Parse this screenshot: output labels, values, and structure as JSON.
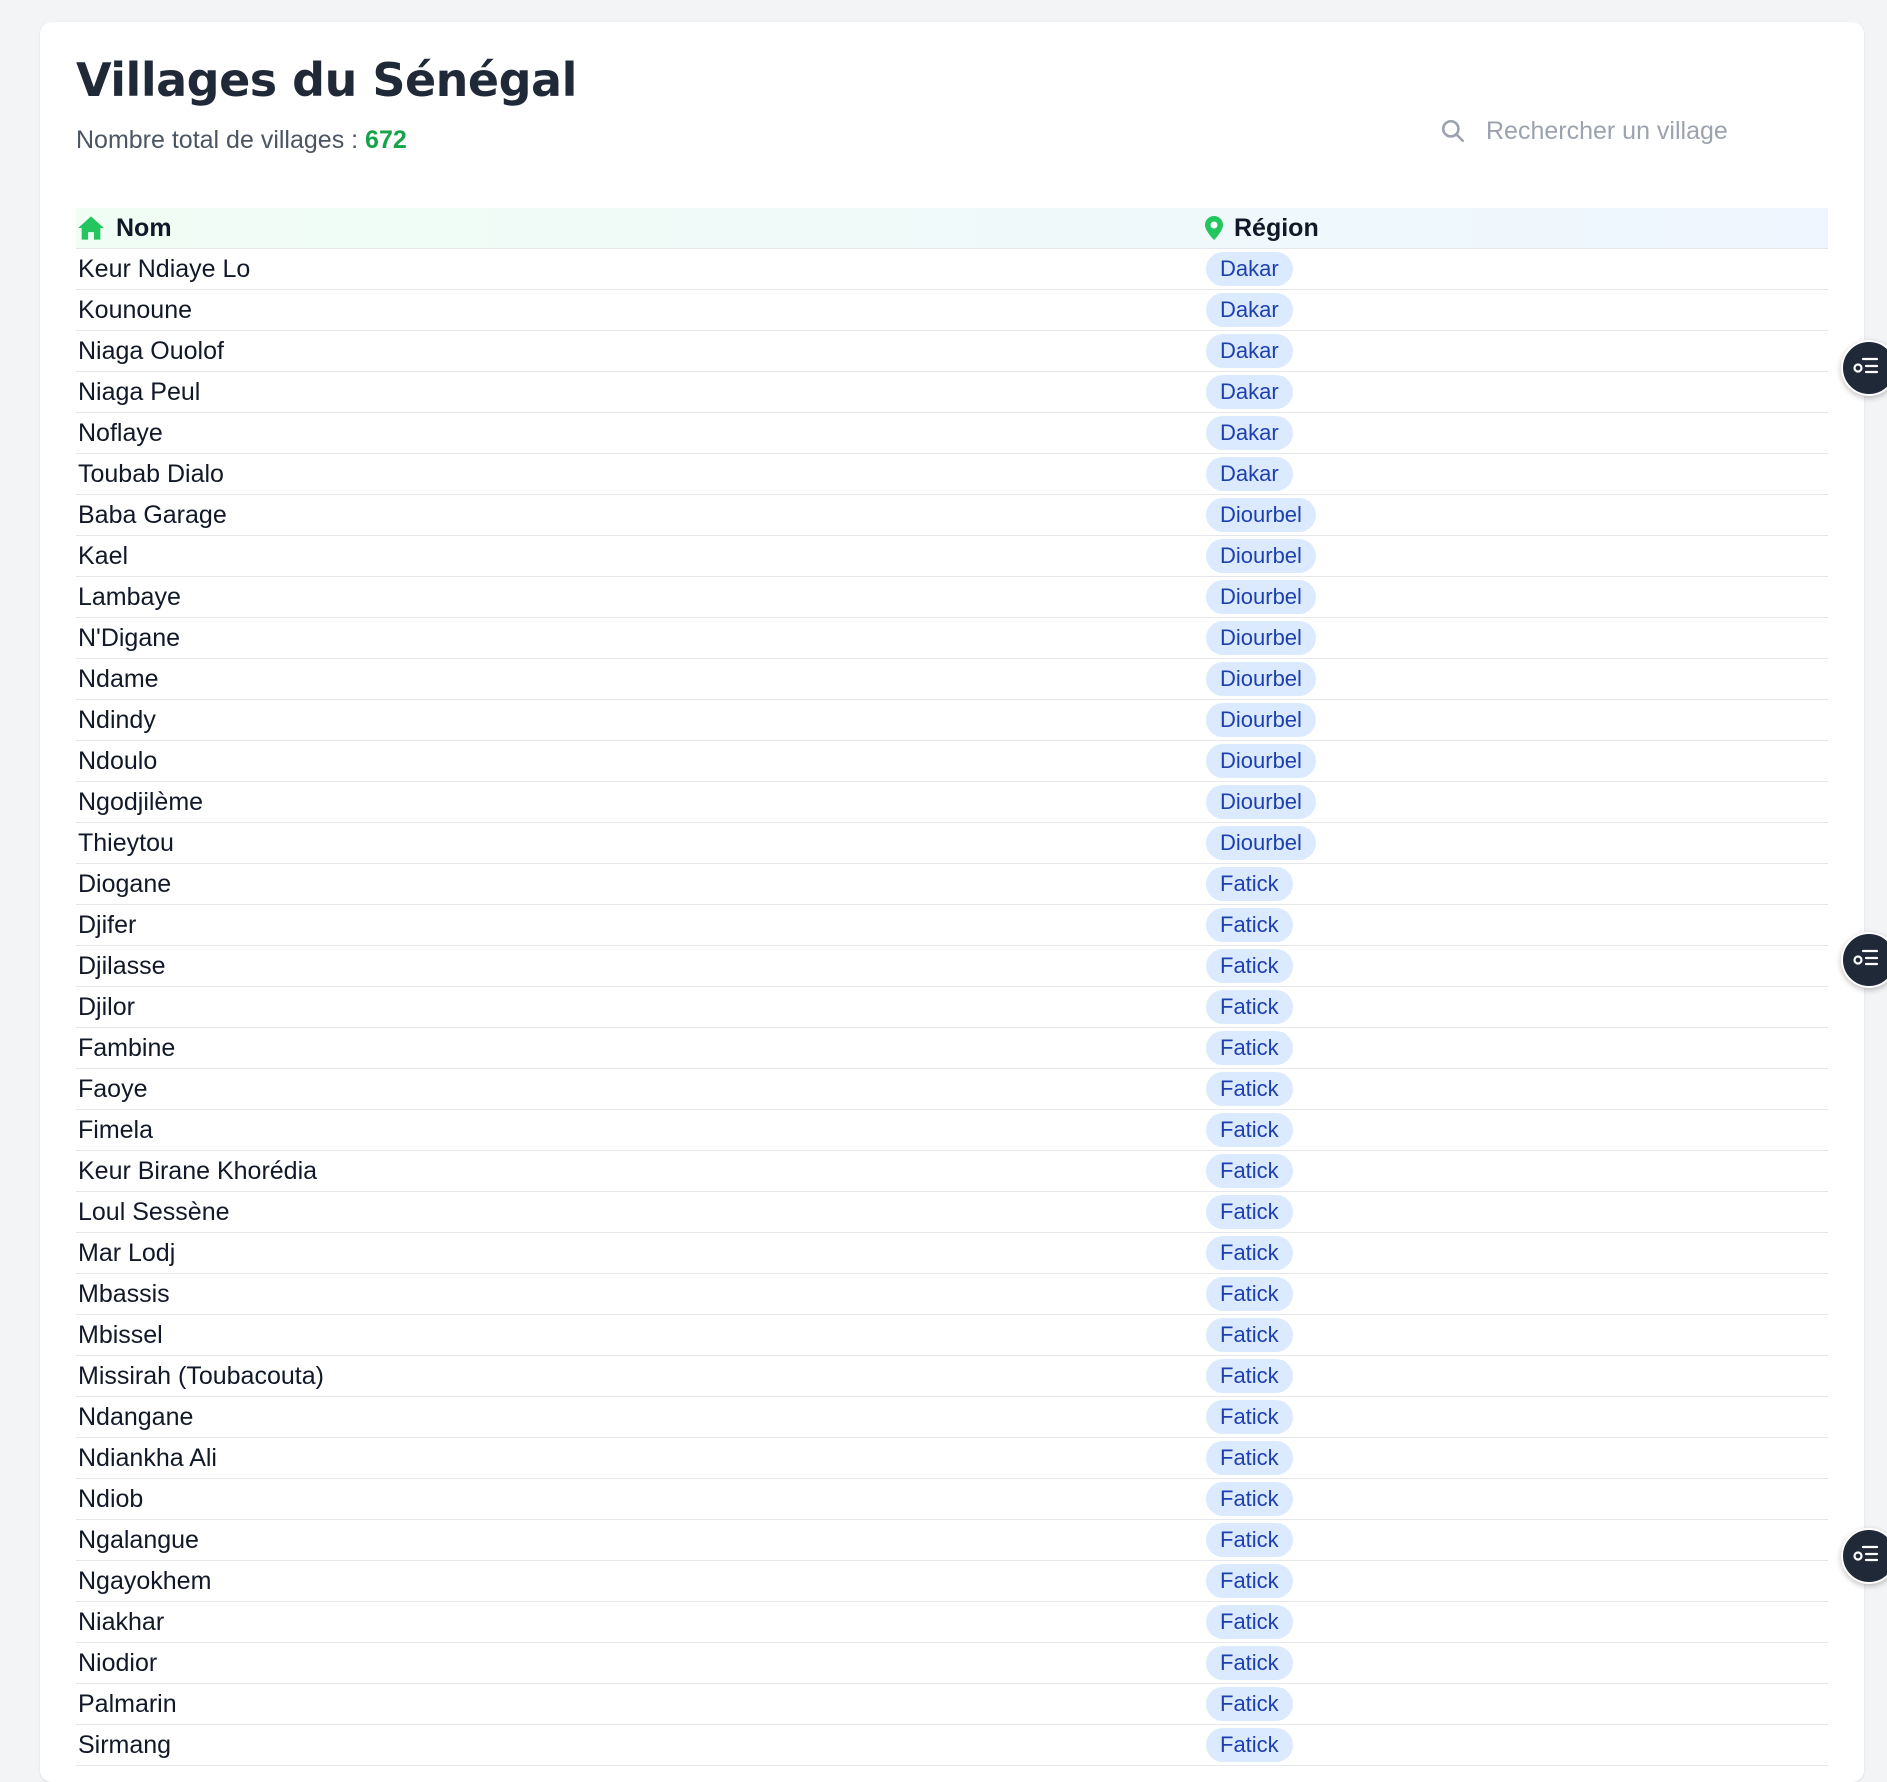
{
  "header": {
    "title": "Villages du Sénégal",
    "subtitle_label": "Nombre total de villages :",
    "total_count": "672"
  },
  "search": {
    "placeholder": "Rechercher un village",
    "icon": "search-icon"
  },
  "table": {
    "columns": [
      {
        "label": "Nom",
        "icon": "home-icon"
      },
      {
        "label": "Région",
        "icon": "map-pin-icon"
      }
    ],
    "rows": [
      {
        "name": "Keur Ndiaye Lo",
        "region": "Dakar"
      },
      {
        "name": "Kounoune",
        "region": "Dakar"
      },
      {
        "name": "Niaga Ouolof",
        "region": "Dakar"
      },
      {
        "name": "Niaga Peul",
        "region": "Dakar"
      },
      {
        "name": "Noflaye",
        "region": "Dakar"
      },
      {
        "name": "Toubab Dialo",
        "region": "Dakar"
      },
      {
        "name": "Baba Garage",
        "region": "Diourbel"
      },
      {
        "name": "Kael",
        "region": "Diourbel"
      },
      {
        "name": "Lambaye",
        "region": "Diourbel"
      },
      {
        "name": "N'Digane",
        "region": "Diourbel"
      },
      {
        "name": "Ndame",
        "region": "Diourbel"
      },
      {
        "name": "Ndindy",
        "region": "Diourbel"
      },
      {
        "name": "Ndoulo",
        "region": "Diourbel"
      },
      {
        "name": "Ngodjilème",
        "region": "Diourbel"
      },
      {
        "name": "Thieytou",
        "region": "Diourbel"
      },
      {
        "name": "Diogane",
        "region": "Fatick"
      },
      {
        "name": "Djifer",
        "region": "Fatick"
      },
      {
        "name": "Djilasse",
        "region": "Fatick"
      },
      {
        "name": "Djilor",
        "region": "Fatick"
      },
      {
        "name": "Fambine",
        "region": "Fatick"
      },
      {
        "name": "Faoye",
        "region": "Fatick"
      },
      {
        "name": "Fimela",
        "region": "Fatick"
      },
      {
        "name": "Keur Birane Khorédia",
        "region": "Fatick"
      },
      {
        "name": "Loul Sessène",
        "region": "Fatick"
      },
      {
        "name": "Mar Lodj",
        "region": "Fatick"
      },
      {
        "name": "Mbassis",
        "region": "Fatick"
      },
      {
        "name": "Mbissel",
        "region": "Fatick"
      },
      {
        "name": "Missirah (Toubacouta)",
        "region": "Fatick"
      },
      {
        "name": "Ndangane",
        "region": "Fatick"
      },
      {
        "name": "Ndiankha Ali",
        "region": "Fatick"
      },
      {
        "name": "Ndiob",
        "region": "Fatick"
      },
      {
        "name": "Ngalangue",
        "region": "Fatick"
      },
      {
        "name": "Ngayokhem",
        "region": "Fatick"
      },
      {
        "name": "Niakhar",
        "region": "Fatick"
      },
      {
        "name": "Niodior",
        "region": "Fatick"
      },
      {
        "name": "Palmarin",
        "region": "Fatick"
      },
      {
        "name": "Sirmang",
        "region": "Fatick"
      }
    ]
  },
  "side_buttons": [
    {
      "icon": "toggle-list-icon"
    },
    {
      "icon": "toggle-list-icon"
    },
    {
      "icon": "toggle-list-icon"
    }
  ],
  "colors": {
    "accent_green": "#16a34a",
    "badge_bg": "#dbeafe",
    "badge_text": "#1e40af",
    "title": "#1f2937"
  }
}
